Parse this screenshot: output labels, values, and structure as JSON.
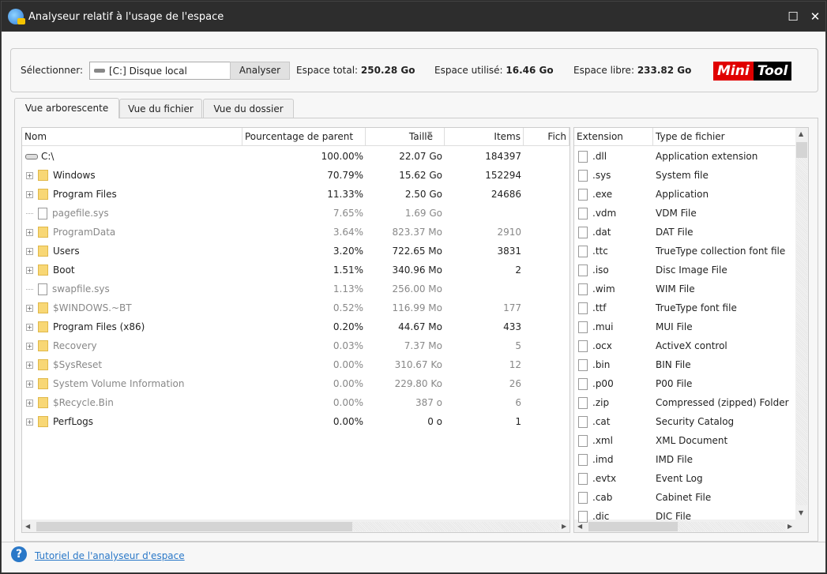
{
  "window": {
    "title": "Analyseur relatif à l'usage de l'espace",
    "maximize": "☐",
    "close": "✕"
  },
  "toolbar": {
    "select_label": "Sélectionner:",
    "drive": "[C:] Disque local",
    "analyze": "Analyser",
    "total_label": "Espace total:",
    "total": "250.28 Go",
    "used_label": "Espace utilisé:",
    "used": "16.46 Go",
    "free_label": "Espace libre:",
    "free": "233.82 Go",
    "logo": {
      "a": "Mini",
      "b": "Tool",
      "color_a": "#e00000",
      "color_b": "#000000"
    }
  },
  "tabs": [
    {
      "label": "Vue arborescente",
      "active": true
    },
    {
      "label": "Vue du fichier"
    },
    {
      "label": "Vue du dossier"
    }
  ],
  "tree": {
    "columns": [
      "Nom",
      "Pourcentage de parent",
      "Taille",
      "Items",
      "Fich"
    ],
    "rows": [
      {
        "name": "C:\\",
        "pct": "100.00%",
        "size": "22.07 Go",
        "items": "184397",
        "type": "drive",
        "gray": false
      },
      {
        "name": "Windows",
        "pct": "70.79%",
        "size": "15.62 Go",
        "items": "152294",
        "type": "folder",
        "gray": false
      },
      {
        "name": "Program Files",
        "pct": "11.33%",
        "size": "2.50 Go",
        "items": "24686",
        "type": "folder",
        "gray": false
      },
      {
        "name": "pagefile.sys",
        "pct": "7.65%",
        "size": "1.69 Go",
        "items": "",
        "type": "file",
        "gray": true
      },
      {
        "name": "ProgramData",
        "pct": "3.64%",
        "size": "823.37 Mo",
        "items": "2910",
        "type": "folder",
        "gray": true
      },
      {
        "name": "Users",
        "pct": "3.20%",
        "size": "722.65 Mo",
        "items": "3831",
        "type": "folder",
        "gray": false
      },
      {
        "name": "Boot",
        "pct": "1.51%",
        "size": "340.96 Mo",
        "items": "2",
        "type": "folder",
        "gray": false
      },
      {
        "name": "swapfile.sys",
        "pct": "1.13%",
        "size": "256.00 Mo",
        "items": "",
        "type": "file",
        "gray": true
      },
      {
        "name": "$WINDOWS.~BT",
        "pct": "0.52%",
        "size": "116.99 Mo",
        "items": "177",
        "type": "folder",
        "gray": true
      },
      {
        "name": "Program Files (x86)",
        "pct": "0.20%",
        "size": "44.67 Mo",
        "items": "433",
        "type": "folder",
        "gray": false
      },
      {
        "name": "Recovery",
        "pct": "0.03%",
        "size": "7.37 Mo",
        "items": "5",
        "type": "folder",
        "gray": true
      },
      {
        "name": "$SysReset",
        "pct": "0.00%",
        "size": "310.67 Ko",
        "items": "12",
        "type": "folder",
        "gray": true
      },
      {
        "name": "System Volume Information",
        "pct": "0.00%",
        "size": "229.80 Ko",
        "items": "26",
        "type": "folder",
        "gray": true
      },
      {
        "name": "$Recycle.Bin",
        "pct": "0.00%",
        "size": "387 o",
        "items": "6",
        "type": "folder",
        "gray": true
      },
      {
        "name": "PerfLogs",
        "pct": "0.00%",
        "size": "0 o",
        "items": "1",
        "type": "folder",
        "gray": false
      }
    ]
  },
  "extensions": {
    "columns": [
      "Extension",
      "Type de fichier"
    ],
    "rows": [
      {
        "ext": ".dll",
        "type": "Application extension"
      },
      {
        "ext": ".sys",
        "type": "System file"
      },
      {
        "ext": ".exe",
        "type": "Application"
      },
      {
        "ext": ".vdm",
        "type": "VDM File"
      },
      {
        "ext": ".dat",
        "type": "DAT File"
      },
      {
        "ext": ".ttc",
        "type": "TrueType collection font file"
      },
      {
        "ext": ".iso",
        "type": "Disc Image File"
      },
      {
        "ext": ".wim",
        "type": "WIM File"
      },
      {
        "ext": ".ttf",
        "type": "TrueType font file"
      },
      {
        "ext": ".mui",
        "type": "MUI File"
      },
      {
        "ext": ".ocx",
        "type": "ActiveX control"
      },
      {
        "ext": ".bin",
        "type": "BIN File"
      },
      {
        "ext": ".p00",
        "type": "P00 File"
      },
      {
        "ext": ".zip",
        "type": "Compressed (zipped) Folder"
      },
      {
        "ext": ".cat",
        "type": "Security Catalog"
      },
      {
        "ext": ".xml",
        "type": "XML Document"
      },
      {
        "ext": ".imd",
        "type": "IMD File"
      },
      {
        "ext": ".evtx",
        "type": "Event Log"
      },
      {
        "ext": ".cab",
        "type": "Cabinet File"
      },
      {
        "ext": ".dic",
        "type": "DIC File"
      }
    ]
  },
  "footer": {
    "link": "Tutoriel de l'analyseur d'espace",
    "help_icon": "?"
  }
}
